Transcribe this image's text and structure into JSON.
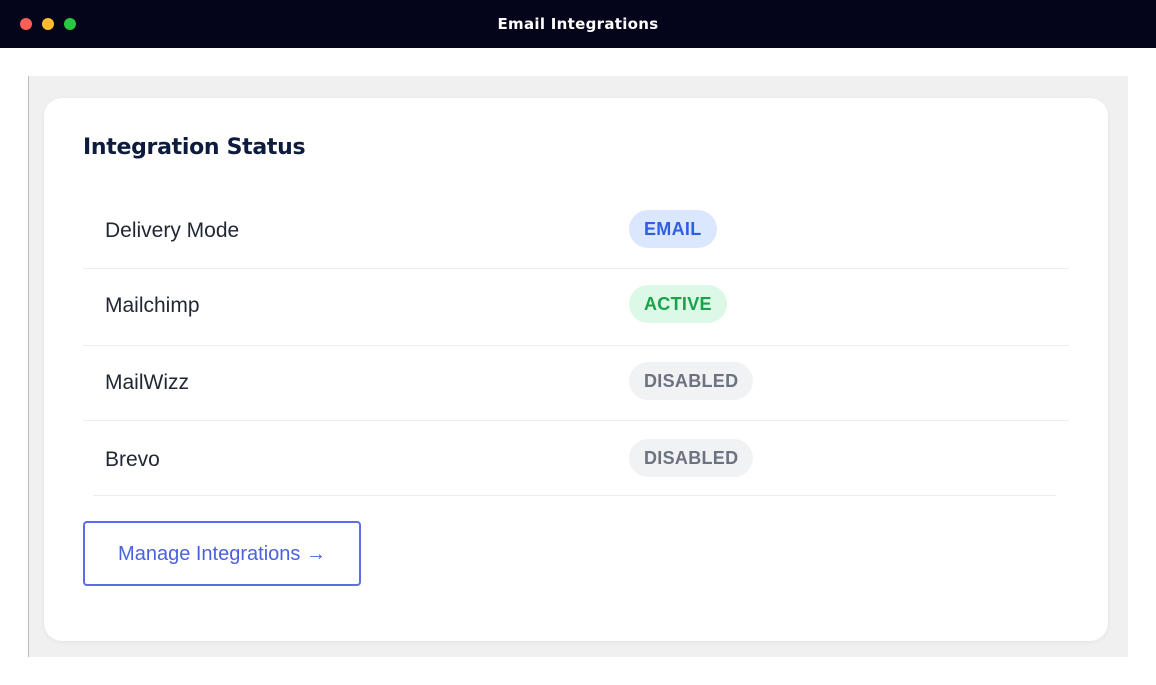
{
  "window": {
    "title": "Email Integrations"
  },
  "card": {
    "title": "Integration Status",
    "rows": [
      {
        "label": "Delivery Mode",
        "status": "EMAIL"
      },
      {
        "label": "Mailchimp",
        "status": "ACTIVE"
      },
      {
        "label": "MailWizz",
        "status": "DISABLED"
      },
      {
        "label": "Brevo",
        "status": "DISABLED"
      }
    ],
    "manage_button": "Manage Integrations →"
  },
  "colors": {
    "titlebar_bg": "#04041a",
    "heading": "#0d1b3e",
    "email_badge_bg": "#dbe6ff",
    "email_badge_text": "#2f5fe0",
    "active_badge_bg": "#dcf8e6",
    "active_badge_text": "#18a34a",
    "disabled_badge_bg": "#f1f2f4",
    "disabled_badge_text": "#6b7280",
    "button_accent": "#4a62e0"
  }
}
